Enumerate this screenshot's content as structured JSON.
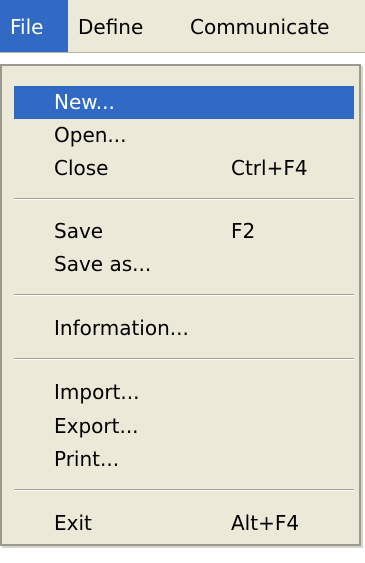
{
  "menubar": {
    "items": [
      {
        "label": "File"
      },
      {
        "label": "Define"
      },
      {
        "label": "Communicate"
      }
    ]
  },
  "file_menu": {
    "items": [
      {
        "label": "New...",
        "shortcut": ""
      },
      {
        "label": "Open...",
        "shortcut": ""
      },
      {
        "label": "Close",
        "shortcut": "Ctrl+F4"
      },
      {
        "label": "Save",
        "shortcut": "F2"
      },
      {
        "label": "Save as...",
        "shortcut": ""
      },
      {
        "label": "Information...",
        "shortcut": ""
      },
      {
        "label": "Import...",
        "shortcut": ""
      },
      {
        "label": "Export...",
        "shortcut": ""
      },
      {
        "label": "Print...",
        "shortcut": ""
      },
      {
        "label": "Exit",
        "shortcut": "Alt+F4"
      }
    ],
    "highlighted_item": "New..."
  },
  "colors": {
    "menu_background": "#ece9d8",
    "highlight": "#316ac5",
    "highlight_text": "#ffffff"
  }
}
